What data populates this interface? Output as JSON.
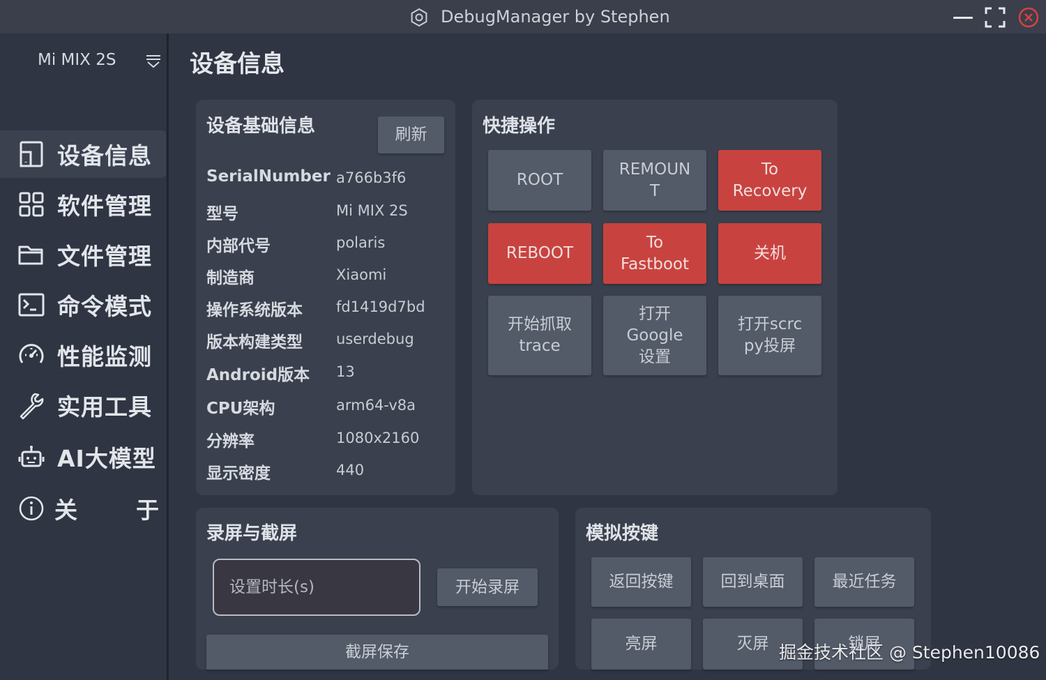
{
  "window": {
    "title": "DebugManager by Stephen"
  },
  "sidebar": {
    "device": "Mi MIX 2S",
    "items": [
      {
        "label": "设备信息",
        "icon": "tablet-icon",
        "active": true
      },
      {
        "label": "软件管理",
        "icon": "apps-grid-icon",
        "active": false
      },
      {
        "label": "文件管理",
        "icon": "folder-icon",
        "active": false
      },
      {
        "label": "命令模式",
        "icon": "terminal-icon",
        "active": false
      },
      {
        "label": "性能监测",
        "icon": "gauge-icon",
        "active": false
      },
      {
        "label": "实用工具",
        "icon": "wrench-icon",
        "active": false
      },
      {
        "label": "AI大模型",
        "icon": "robot-icon",
        "active": false
      },
      {
        "label": "关　　于",
        "icon": "info-icon",
        "active": false
      }
    ]
  },
  "page": {
    "title": "设备信息"
  },
  "device_info": {
    "title": "设备基础信息",
    "refresh_label": "刷新",
    "rows": [
      {
        "key": "SerialNumber",
        "value": "a766b3f6"
      },
      {
        "key": "型号",
        "value": "Mi MIX 2S"
      },
      {
        "key": "内部代号",
        "value": "polaris"
      },
      {
        "key": "制造商",
        "value": "Xiaomi"
      },
      {
        "key": "操作系统版本",
        "value": "fd1419d7bd"
      },
      {
        "key": "版本构建类型",
        "value": "userdebug"
      },
      {
        "key": "Android版本",
        "value": "13"
      },
      {
        "key": "CPU架构",
        "value": "arm64-v8a"
      },
      {
        "key": "分辨率",
        "value": "1080x2160"
      },
      {
        "key": "显示密度",
        "value": "440"
      }
    ]
  },
  "quick_actions": {
    "title": "快捷操作",
    "buttons": [
      {
        "label": "ROOT",
        "style": "normal"
      },
      {
        "label": "REMOUNT",
        "style": "normal"
      },
      {
        "label": "To Recovery",
        "style": "danger"
      },
      {
        "label": "REBOOT",
        "style": "danger"
      },
      {
        "label": "To Fastboot",
        "style": "danger"
      },
      {
        "label": "关机",
        "style": "danger"
      },
      {
        "label": "开始抓取trace",
        "style": "normal"
      },
      {
        "label": "打开Google设置",
        "style": "normal"
      },
      {
        "label": "打开scrcpy投屏",
        "style": "normal"
      }
    ]
  },
  "screen_record": {
    "title": "录屏与截屏",
    "duration_placeholder": "设置时长(s)",
    "start_label": "开始录屏",
    "screenshot_label": "截屏保存"
  },
  "keys": {
    "title": "模拟按键",
    "buttons": [
      "返回按键",
      "回到桌面",
      "最近任务",
      "亮屏",
      "灭屏",
      "锁屏"
    ]
  },
  "watermark": "掘金技术社区 @ Stephen10086",
  "colors": {
    "background": "#2f3542",
    "card": "#3a404d",
    "button": "#535a68",
    "danger": "#c8433f",
    "close": "#d84040"
  }
}
